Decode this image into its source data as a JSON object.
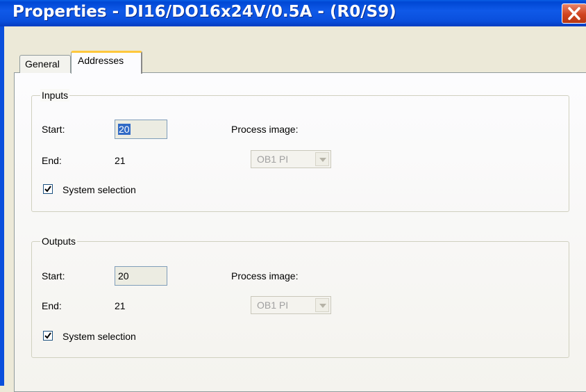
{
  "window": {
    "title": "Properties - DI16/DO16x24V/0.5A - (R0/S9)",
    "close_icon": "close-icon"
  },
  "tabs": [
    {
      "label": "General",
      "active": false
    },
    {
      "label": "Addresses",
      "active": true
    }
  ],
  "inputs": {
    "legend": "Inputs",
    "start_label": "Start:",
    "start_value": "20",
    "end_label": "End:",
    "end_value": "21",
    "process_image_label": "Process image:",
    "process_image_value": "OB1 PI",
    "system_selection_label": "System selection",
    "system_selection_checked": true
  },
  "outputs": {
    "legend": "Outputs",
    "start_label": "Start:",
    "start_value": "20",
    "end_label": "End:",
    "end_value": "21",
    "process_image_label": "Process image:",
    "process_image_value": "OB1 PI",
    "system_selection_label": "System selection",
    "system_selection_checked": true
  },
  "colors": {
    "titlebar": "#0a4fdc",
    "close_button": "#d0441f",
    "dialog_bg": "#ece9d8",
    "tab_highlight": "#ffc83c",
    "selection": "#316ac5"
  }
}
